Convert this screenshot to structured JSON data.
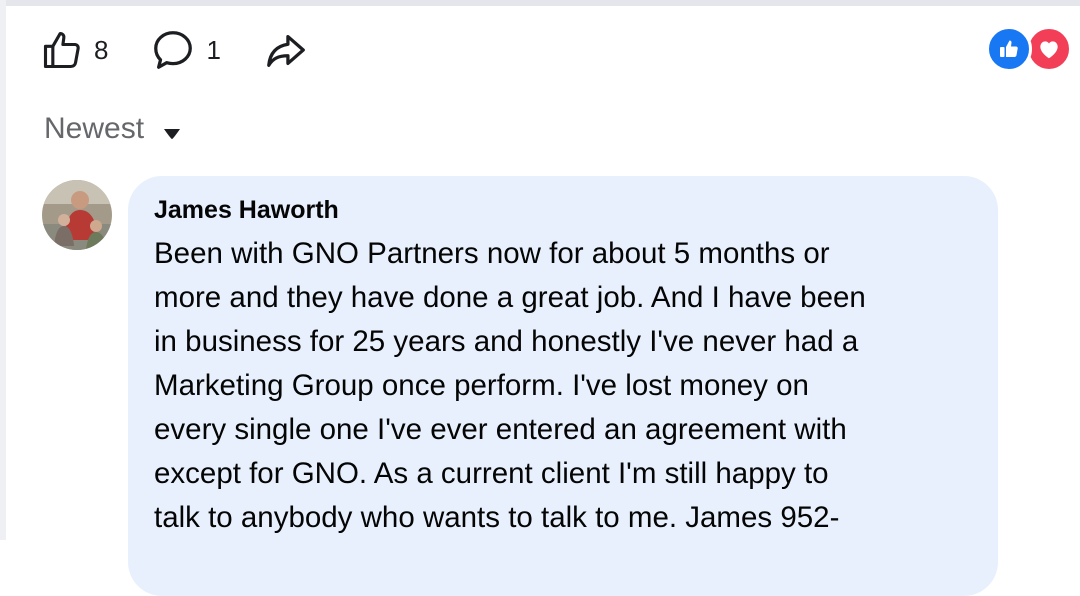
{
  "post_actions": {
    "like_count": "8",
    "comment_count": "1",
    "icons": {
      "like": "thumbs-up-icon",
      "comment": "comment-bubble-icon",
      "share": "share-arrow-icon"
    }
  },
  "reaction_summary": {
    "icons": [
      "like-reaction-icon",
      "love-reaction-icon"
    ],
    "colors": {
      "like": "#1877f2",
      "love": "#f33e58"
    }
  },
  "comments_sort": {
    "label": "Newest"
  },
  "comment": {
    "author": "James Haworth",
    "lines": [
      "Been with GNO Partners now for about 5 months or",
      "more and they have done a great job. And I have been",
      "in business for 25 years and honestly I've never had a",
      "Marketing Group once perform. I've lost money on",
      "every single one I've ever entered an agreement with",
      "except for GNO. As a current client I'm still happy to",
      "talk to anybody who wants to talk to me. James 952-"
    ]
  },
  "colors": {
    "bubble": "#e7f0fc",
    "secondary_text": "#65676b",
    "primary_text": "#050505"
  }
}
